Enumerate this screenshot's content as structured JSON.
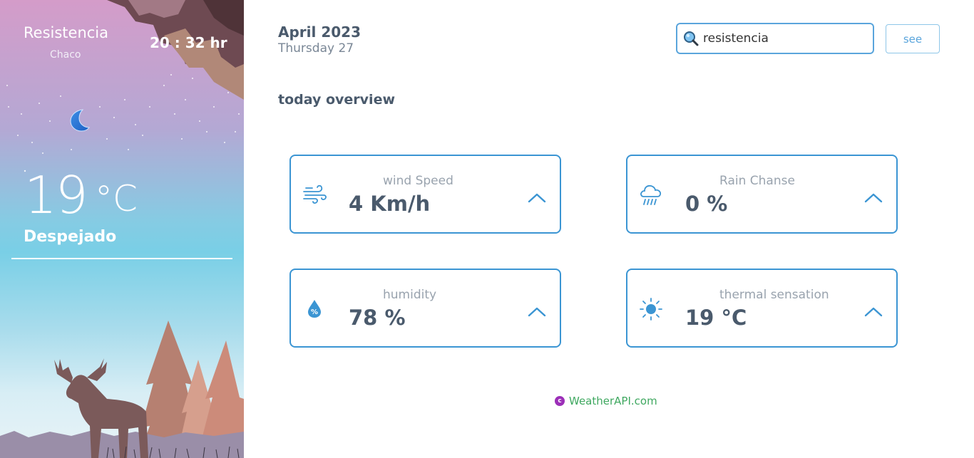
{
  "location": {
    "city": "Resistencia",
    "region": "Chaco",
    "time": "20 : 32 hr"
  },
  "current": {
    "temperature": "19",
    "unit": "°C",
    "condition": "Despejado",
    "weather_icon": "moon-icon"
  },
  "header": {
    "month_year": "April 2023",
    "weekday_day": "Thursday 27"
  },
  "search": {
    "value": "resistencia",
    "button_label": "see"
  },
  "overview": {
    "title": "today overview",
    "cards": [
      {
        "label": "wind Speed",
        "value": "4 Km/h",
        "icon": "wind-icon"
      },
      {
        "label": "Rain Chanse",
        "value": "0 %",
        "icon": "rain-cloud-icon"
      },
      {
        "label": "humidity",
        "value": "78 %",
        "icon": "humidity-drop-icon"
      },
      {
        "label": "thermal sensation",
        "value": "19 °C",
        "icon": "sun-icon"
      }
    ]
  },
  "footer": {
    "credit": "WeatherAPI.com",
    "credit_symbol": "c"
  },
  "colors": {
    "accent": "#3b95d3",
    "text": "#4a5a6c",
    "label": "#99a3ae",
    "credit": "#3fa860"
  }
}
